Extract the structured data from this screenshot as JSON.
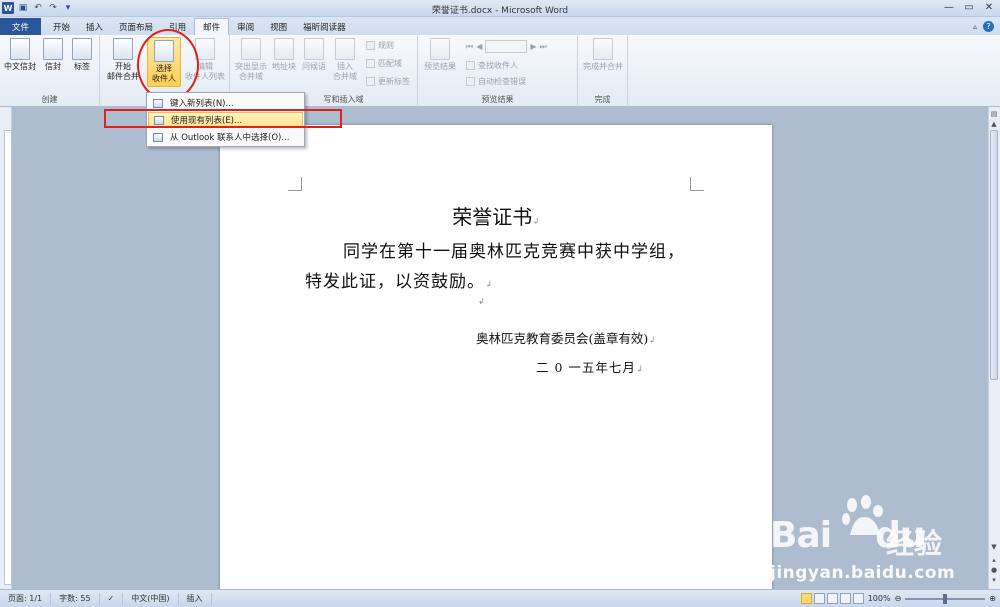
{
  "window": {
    "title": "荣誉证书.docx - Microsoft Word"
  },
  "tabs": [
    {
      "label": "文件"
    },
    {
      "label": "开始"
    },
    {
      "label": "插入"
    },
    {
      "label": "页面布局"
    },
    {
      "label": "引用"
    },
    {
      "label": "邮件"
    },
    {
      "label": "审阅"
    },
    {
      "label": "视图"
    },
    {
      "label": "福昕阅读器"
    }
  ],
  "ribbon": {
    "create": {
      "label": "创建",
      "chinese_envelope": "中文信封",
      "envelope": "信封",
      "labels": "标签"
    },
    "start_merge": {
      "label": "开",
      "start_line1": "开始",
      "start_line2": "邮件合并",
      "select_line1": "选择",
      "select_line2": "收件人",
      "edit_line1": "编辑",
      "edit_line2": "收件人列表"
    },
    "write_insert": {
      "label": "写和插入域",
      "highlight_line1": "突出显示",
      "highlight_line2": "合并域",
      "address": "地址块",
      "greeting": "问候语",
      "insert_line1": "插入",
      "insert_line2": "合并域",
      "rules": "规则",
      "match": "匹配域",
      "update": "更新标签"
    },
    "preview": {
      "label": "预览结果",
      "preview_btn": "预览结果",
      "find": "查找收件人",
      "check": "自动检查错误"
    },
    "finish": {
      "label": "完成",
      "finish_line1": "完成并合并"
    }
  },
  "menu": {
    "items": [
      {
        "label": "键入新列表(N)..."
      },
      {
        "label": "使用现有列表(E)..."
      },
      {
        "label": "从 Outlook 联系人中选择(O)..."
      }
    ]
  },
  "document": {
    "title": "荣誉证书",
    "body": "同学在第十一届奥林匹克竞赛中获中学组，特发此证，以资鼓励。",
    "signature": "奥林匹克教育委员会(盖章有效)",
    "date": "二 0 一五年七月"
  },
  "status": {
    "page": "页面: 1/1",
    "words": "字数: 55",
    "language": "中文(中国)",
    "mode": "插入",
    "zoom": "100%"
  },
  "watermark": {
    "brand": "Bai",
    "brand2": "du",
    "cn": "经验",
    "url": "jingyan.baidu.com"
  }
}
